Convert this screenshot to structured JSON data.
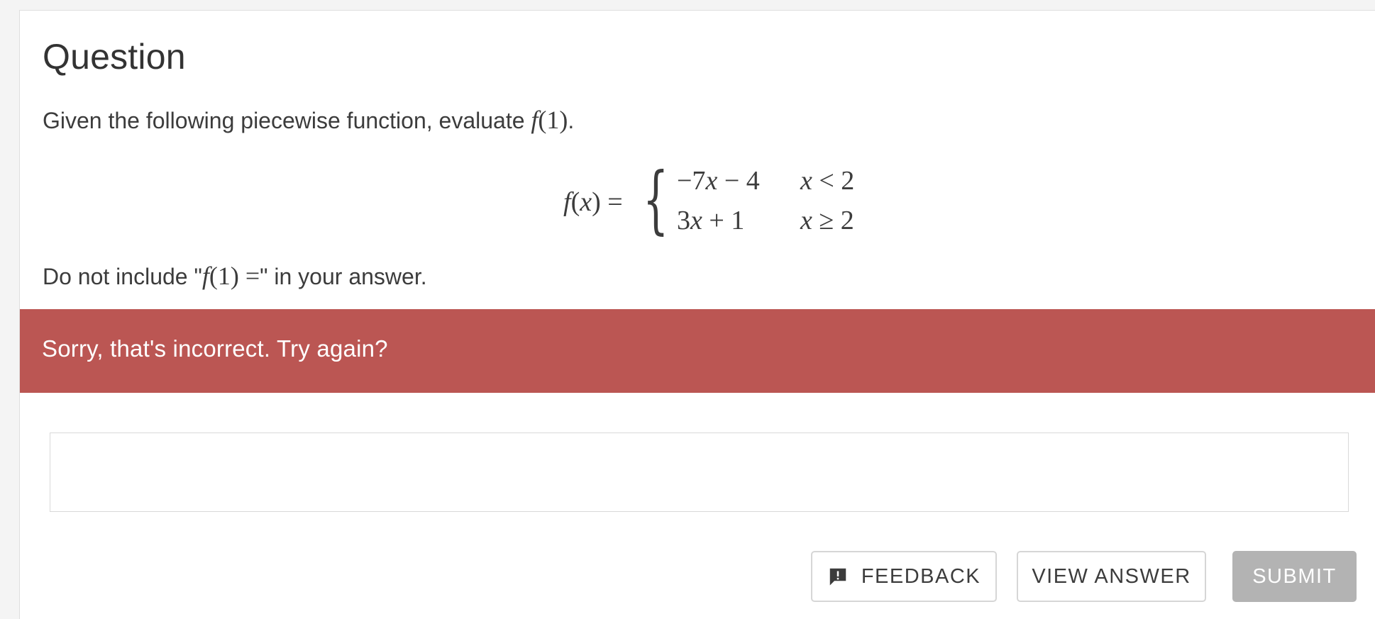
{
  "question": {
    "title": "Question",
    "prompt_text": "Given the following piecewise function, evaluate ",
    "prompt_math": "f(1)",
    "prompt_end": ".",
    "equation": {
      "lhs": "f(x) =",
      "cases": [
        {
          "expr": "−7x − 4",
          "cond": "x < 2"
        },
        {
          "expr": "3x + 1",
          "cond": "x ≥ 2"
        }
      ]
    },
    "note_prefix": "Do not include \"",
    "note_math": "f(1) =",
    "note_suffix": "\" in your answer."
  },
  "feedback_banner": {
    "message": "Sorry, that's incorrect. Try again?",
    "color": "#bb5653"
  },
  "answer": {
    "value": "",
    "placeholder": ""
  },
  "buttons": {
    "feedback_label": "FEEDBACK",
    "feedback_icon": "feedback-exclamation-icon",
    "view_answer_label": "VIEW ANSWER",
    "submit_label": "SUBMIT"
  }
}
